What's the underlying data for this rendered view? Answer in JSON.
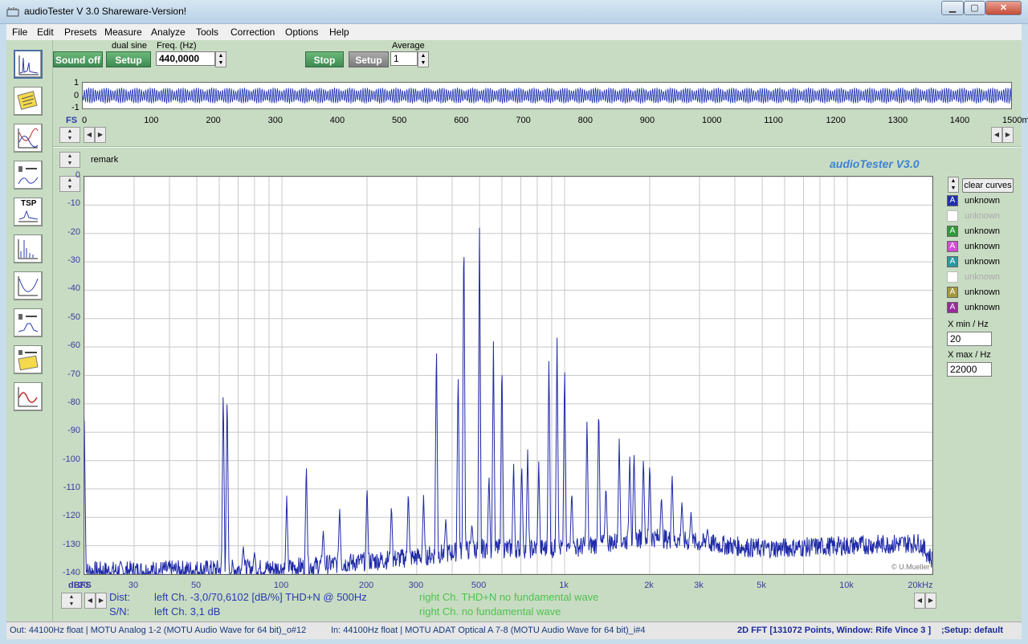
{
  "window": {
    "title": "audioTester  V 3.0 Shareware-Version!",
    "min": "▁",
    "max": "▢",
    "close": "✕"
  },
  "menu": [
    "File",
    "Edit",
    "Presets",
    "Measure",
    "Analyze",
    "Tools",
    "Correction",
    "Options",
    "Help"
  ],
  "toolbar_icons": [
    "fft-icon",
    "multitone-icon",
    "frequency-response-icon",
    "speaker-sweep-icon",
    "tsp-icon",
    "spectrum-icon",
    "impedance-icon",
    "speaker-curve-icon",
    "multiplex-icon",
    "generator-icon"
  ],
  "tsp_label": "TSP",
  "generator": {
    "sound_btn": "Sound off",
    "mode_label": "dual sine",
    "setup_btn": "Setup",
    "freq_label": "Freq. (Hz)",
    "freq_value": "440,0000"
  },
  "analyzer": {
    "stop_btn": "Stop",
    "setup_btn": "Setup",
    "average_label": "Average",
    "average_value": "1"
  },
  "scope": {
    "y_ticks": [
      "1",
      "0",
      "-1"
    ],
    "fs_label": "FS",
    "x_ticks": [
      "0",
      "100",
      "200",
      "300",
      "400",
      "500",
      "600",
      "700",
      "800",
      "900",
      "1000",
      "1100",
      "1200",
      "1300",
      "1400",
      "1500ms"
    ]
  },
  "plot": {
    "remark": "remark",
    "brand": "audioTester  V3.0",
    "copyright": "© U.Mueller",
    "unit_label": "dBFS"
  },
  "chart_data": {
    "type": "line",
    "title": "",
    "xlabel": "Hz",
    "ylabel": "dBFS",
    "x_scale": "log",
    "xlim": [
      20,
      20000
    ],
    "ylim": [
      -140,
      0
    ],
    "grid": true,
    "y_ticks": [
      "0",
      "-10",
      "-20",
      "-30",
      "-40",
      "-50",
      "-60",
      "-70",
      "-80",
      "-90",
      "-100",
      "-110",
      "-120",
      "-130",
      "-140"
    ],
    "x_ticks": [
      {
        "v": 20,
        "label": "20"
      },
      {
        "v": 30,
        "label": "30"
      },
      {
        "v": 50,
        "label": "50"
      },
      {
        "v": 100,
        "label": "100"
      },
      {
        "v": 200,
        "label": "200"
      },
      {
        "v": 300,
        "label": "300"
      },
      {
        "v": 500,
        "label": "500"
      },
      {
        "v": 1000,
        "label": "1k"
      },
      {
        "v": 2000,
        "label": "2k"
      },
      {
        "v": 3000,
        "label": "3k"
      },
      {
        "v": 5000,
        "label": "5k"
      },
      {
        "v": 10000,
        "label": "10k"
      },
      {
        "v": 20000,
        "label": "20kHz"
      }
    ],
    "noise_floor": [
      [
        20,
        -139
      ],
      [
        100,
        -138
      ],
      [
        300,
        -134
      ],
      [
        500,
        -131
      ],
      [
        1000,
        -131
      ],
      [
        2000,
        -127
      ],
      [
        3000,
        -129
      ],
      [
        5000,
        -131
      ],
      [
        10000,
        -130
      ],
      [
        18000,
        -129
      ],
      [
        20000,
        -135
      ]
    ],
    "peaks": [
      {
        "f": 20,
        "db": -86
      },
      {
        "f": 62,
        "db": -73
      },
      {
        "f": 64,
        "db": -74
      },
      {
        "f": 73,
        "db": -130
      },
      {
        "f": 80,
        "db": -132
      },
      {
        "f": 104,
        "db": -112
      },
      {
        "f": 122,
        "db": -100
      },
      {
        "f": 140,
        "db": -124
      },
      {
        "f": 160,
        "db": -116
      },
      {
        "f": 200,
        "db": -108
      },
      {
        "f": 244,
        "db": -115
      },
      {
        "f": 280,
        "db": -110
      },
      {
        "f": 317,
        "db": -112
      },
      {
        "f": 352,
        "db": -56
      },
      {
        "f": 380,
        "db": -120
      },
      {
        "f": 420,
        "db": -66
      },
      {
        "f": 440,
        "db": -14
      },
      {
        "f": 470,
        "db": -122
      },
      {
        "f": 500,
        "db": -14
      },
      {
        "f": 540,
        "db": -104
      },
      {
        "f": 560,
        "db": -58
      },
      {
        "f": 600,
        "db": -62
      },
      {
        "f": 660,
        "db": -100
      },
      {
        "f": 705,
        "db": -100
      },
      {
        "f": 740,
        "db": -96
      },
      {
        "f": 810,
        "db": -100
      },
      {
        "f": 880,
        "db": -62
      },
      {
        "f": 940,
        "db": -56
      },
      {
        "f": 1000,
        "db": -64
      },
      {
        "f": 1060,
        "db": -110
      },
      {
        "f": 1200,
        "db": -84
      },
      {
        "f": 1320,
        "db": -79
      },
      {
        "f": 1400,
        "db": -108
      },
      {
        "f": 1560,
        "db": -92
      },
      {
        "f": 1700,
        "db": -98
      },
      {
        "f": 1760,
        "db": -96
      },
      {
        "f": 1900,
        "db": -98
      },
      {
        "f": 2000,
        "db": -100
      },
      {
        "f": 2200,
        "db": -112
      },
      {
        "f": 2400,
        "db": -104
      },
      {
        "f": 2600,
        "db": -114
      },
      {
        "f": 2800,
        "db": -118
      },
      {
        "f": 3200,
        "db": -124
      }
    ]
  },
  "legend": {
    "clear_btn": "clear curves",
    "items": [
      {
        "label": "unknown",
        "color": "#1f2fb0",
        "chip": "A",
        "enabled": true
      },
      {
        "label": "unknown",
        "color": "#ffffff",
        "chip": "",
        "enabled": false
      },
      {
        "label": "unknown",
        "color": "#2e9a3a",
        "chip": "A",
        "enabled": true
      },
      {
        "label": "unknown",
        "color": "#d24dd8",
        "chip": "A",
        "enabled": true
      },
      {
        "label": "unknown",
        "color": "#289aa3",
        "chip": "A",
        "enabled": true
      },
      {
        "label": "unknown",
        "color": "#ffffff",
        "chip": "",
        "enabled": false
      },
      {
        "label": "unknown",
        "color": "#a29a3a",
        "chip": "A",
        "enabled": true
      },
      {
        "label": "unknown",
        "color": "#9a2a9a",
        "chip": "A",
        "enabled": true
      }
    ],
    "xmin_label": "X min / Hz",
    "xmin_value": "20",
    "xmax_label": "X max / Hz",
    "xmax_value": "22000"
  },
  "stats": {
    "dist_label": "Dist:",
    "dist_left": "left Ch. -3,0/70,6102 [dB/%] THD+N  @ 500Hz",
    "sn_label": "S/N:",
    "sn_left": "left Ch. 3,1 dB",
    "dist_right": "right Ch. THD+N  no fundamental wave",
    "sn_right": "right Ch.  no fundamental wave"
  },
  "status": {
    "out": "Out: 44100Hz float  | MOTU Analog 1-2 (MOTU Audio Wave for 64 bit)_o#12",
    "in": "In: 44100Hz float  | MOTU ADAT Optical A 7-8 (MOTU Audio Wave for 64 bit)_i#4",
    "fft": "2D FFT [131072 Points, Window: Rife Vince 3 ]",
    "setup": ";Setup:  default"
  }
}
